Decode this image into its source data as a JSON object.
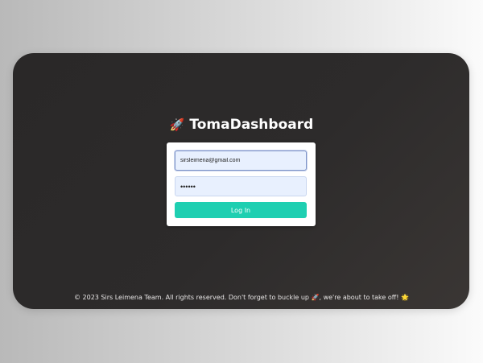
{
  "brand": {
    "icon": "rocket-icon",
    "icon_glyph": "🚀",
    "title": "TomaDashboard"
  },
  "login": {
    "email_value": "sirsleimena@gmail.com",
    "password_value": "••••••",
    "submit_label": "Log In"
  },
  "footer": {
    "text": "© 2023 Sirs Leimena Team. All rights reserved. Don't forget to buckle up 🚀, we're about to take off! 🌟"
  },
  "colors": {
    "accent": "#1ecfb1",
    "window_bg": "#2d2b2b",
    "input_bg": "#e8f0fe"
  }
}
